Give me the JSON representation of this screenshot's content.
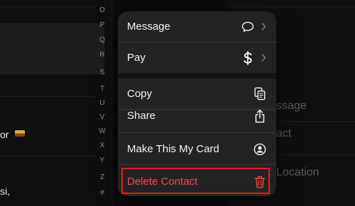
{
  "background": {
    "left_list": {
      "flagged_name_fragment": "or",
      "bottom_name_fragment": "si,"
    },
    "alphabet_index": [
      "O",
      "P",
      "Q",
      "R",
      "S",
      "T",
      "U",
      "V",
      "W",
      "X",
      "Y",
      "Z",
      "#"
    ],
    "detail_fragments": [
      "ssage",
      "act",
      "Location"
    ]
  },
  "context_menu": {
    "items": [
      {
        "id": "message",
        "label": "Message",
        "icon": "message-bubble-icon",
        "has_chevron": true
      },
      {
        "id": "pay",
        "label": "Pay",
        "icon": "dollar-sign-icon",
        "has_chevron": true
      },
      {
        "id": "copy",
        "label": "Copy",
        "icon": "copy-icon",
        "has_chevron": false
      },
      {
        "id": "share",
        "label": "Share",
        "icon": "share-icon",
        "has_chevron": false
      },
      {
        "id": "make-my-card",
        "label": "Make This My Card",
        "icon": "person-circle-icon",
        "has_chevron": false
      },
      {
        "id": "delete-contact",
        "label": "Delete Contact",
        "icon": "trash-icon",
        "has_chevron": false,
        "destructive": true
      }
    ]
  },
  "colors": {
    "menu_background": "#232326",
    "destructive": "#ff453a",
    "highlight_outline": "#e41b1b"
  }
}
